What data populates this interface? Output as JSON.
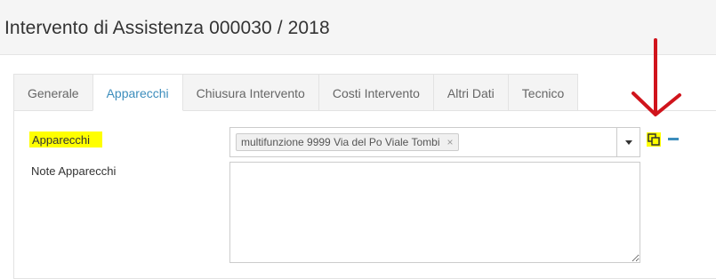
{
  "header": {
    "title": "Intervento di Assistenza 000030 / 2018"
  },
  "tabs": [
    {
      "label": "Generale",
      "active": false
    },
    {
      "label": "Apparecchi",
      "active": true
    },
    {
      "label": "Chiusura Intervento",
      "active": false
    },
    {
      "label": "Costi Intervento",
      "active": false
    },
    {
      "label": "Altri Dati",
      "active": false
    },
    {
      "label": "Tecnico",
      "active": false
    }
  ],
  "form": {
    "apparecchi_label": "Apparecchi",
    "apparecchi_selected": "multifunzione 9999 Via del Po Viale Tombi",
    "chip_remove_symbol": "×",
    "note_label": "Note Apparecchi",
    "note_value": ""
  },
  "colors": {
    "highlight": "#ffff00",
    "accent": "#3c8dbc",
    "annotation_arrow": "#d0141c"
  },
  "icons": {
    "add": "copy-add-icon",
    "remove": "minus-icon",
    "dropdown": "caret-down-icon",
    "annotation": "red-arrow-annotation"
  }
}
